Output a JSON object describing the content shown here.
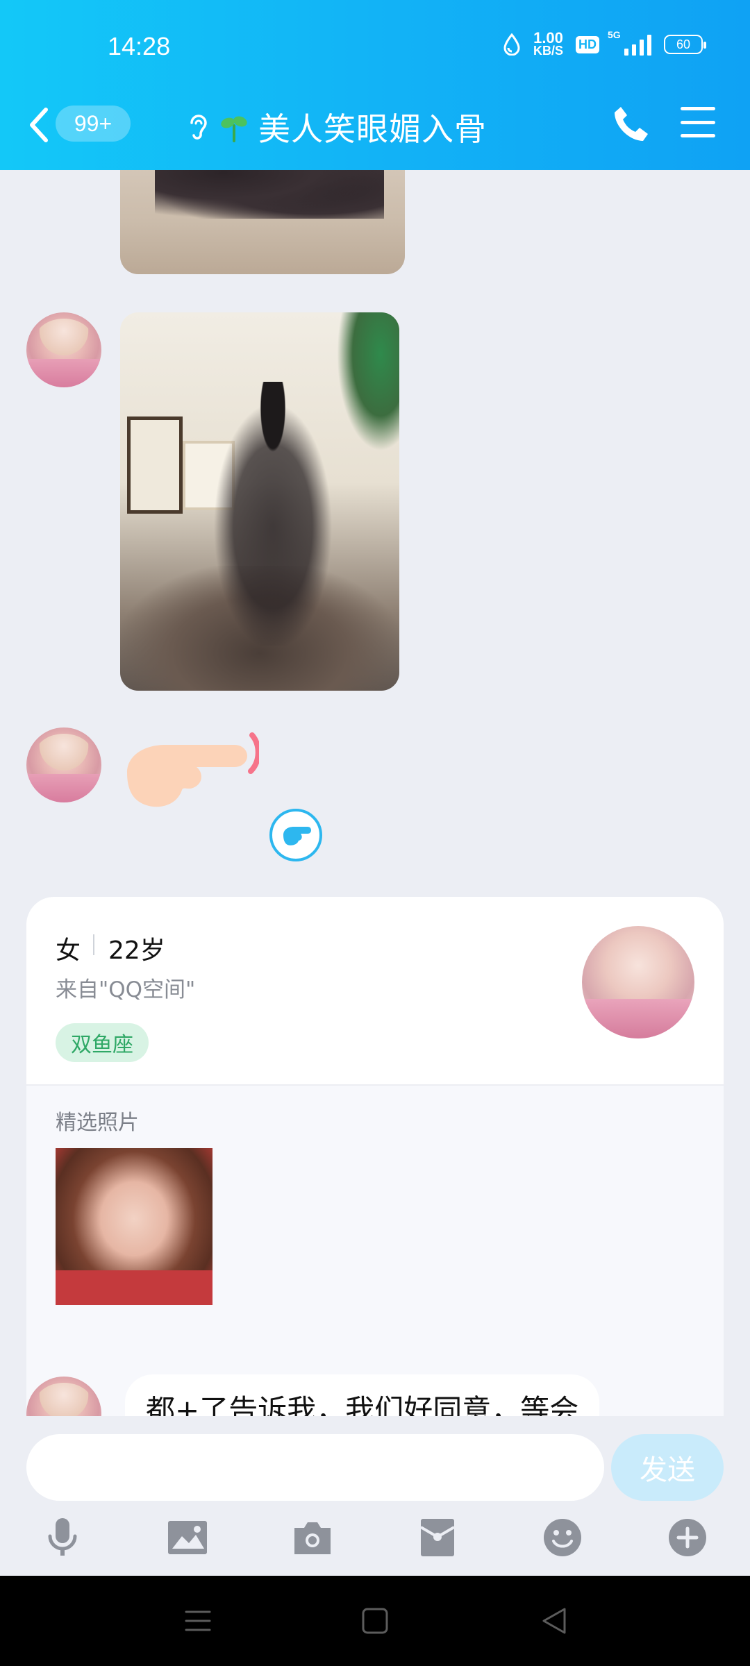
{
  "status_bar": {
    "time": "14:28",
    "net_speed_value": "1.00",
    "net_speed_unit": "KB/S",
    "hd_badge": "HD",
    "network": "5G",
    "battery": "60"
  },
  "header": {
    "unread_badge": "99+",
    "title": "美人笑眼媚入骨",
    "icons": [
      "back-icon",
      "ear-icon",
      "sprout-icon",
      "phone-icon",
      "menu-icon"
    ]
  },
  "profile_card": {
    "gender": "女",
    "age": "22岁",
    "source": "来自\"QQ空间\"",
    "tag": "双鱼座",
    "section_title": "精选照片"
  },
  "last_message": {
    "text": "都+了告诉我，我们好同意，等会"
  },
  "input_bar": {
    "placeholder": "",
    "send_label": "发送",
    "tools": [
      "microphone-icon",
      "image-icon",
      "camera-icon",
      "red-packet-icon",
      "emoji-icon",
      "plus-icon"
    ]
  },
  "colors": {
    "header_gradient_start": "#13c8f8",
    "header_gradient_end": "#0fa2f4",
    "send_button": "#c9ebfb",
    "tag_bg": "#d8f3e4",
    "tag_text": "#2fa866"
  }
}
